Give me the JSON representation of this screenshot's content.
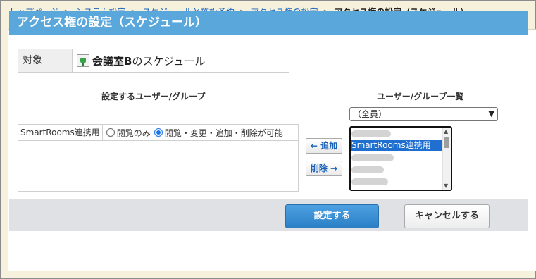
{
  "breadcrumb": {
    "items": [
      "トップページ",
      "システム設定",
      "スケジュールと施設予約",
      "アクセス権の設定"
    ],
    "current": "アクセス権の設定（スケジュール）",
    "separator": ">"
  },
  "title": "アクセス権の設定（スケジュール）",
  "target": {
    "label": "対象",
    "facility_name": "会議室B",
    "facility_suffix": " のスケジュール",
    "icon": "facility-icon"
  },
  "left_column": {
    "heading": "設定するユーザー/グループ",
    "rows": [
      {
        "name": "SmartRooms連携用",
        "option_view": "閲覧のみ",
        "option_full": "閲覧・変更・追加・削除が可能",
        "selected": "full"
      }
    ]
  },
  "buttons": {
    "add": "← 追加",
    "remove": "削除 →",
    "submit": "設定する",
    "cancel": "キャンセルする"
  },
  "right_column": {
    "heading": "ユーザー/グループ一覧",
    "filter_value": "（全員）",
    "list": [
      {
        "label": "",
        "blurred": true
      },
      {
        "label": "SmartRooms連携用",
        "blurred": false,
        "selected": true
      },
      {
        "label": "",
        "blurred": true
      },
      {
        "label": "",
        "blurred": true
      },
      {
        "label": "",
        "blurred": true
      }
    ]
  },
  "colors": {
    "title_bar": "#5aa7dc",
    "link": "#1a63b8",
    "primary_button": "#2b7fc6",
    "selection": "#1e6fd0",
    "page_background": "#f6f1dd"
  }
}
